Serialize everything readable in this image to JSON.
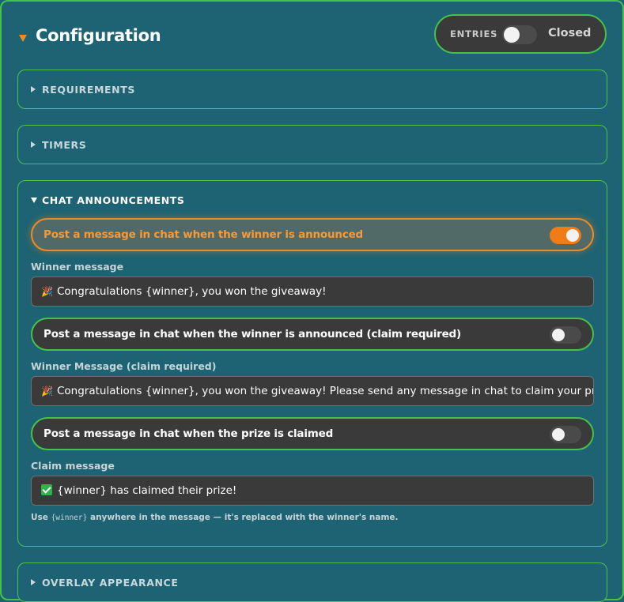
{
  "header": {
    "title": "Configuration",
    "entries_label": "ENTRIES",
    "entries_state": "Closed",
    "entries_open": false
  },
  "sections": {
    "requirements": {
      "label": "REQUIREMENTS",
      "expanded": false
    },
    "timers": {
      "label": "TIMERS",
      "expanded": false
    },
    "chat_announcements": {
      "label": "CHAT ANNOUNCEMENTS",
      "expanded": true,
      "winner_toggle": {
        "label": "Post a message in chat when the winner is announced",
        "on": true
      },
      "winner_message": {
        "label": "Winner message",
        "icon": "party-popper-icon",
        "value": "Congratulations {winner}, you won the giveaway!"
      },
      "claim_toggle": {
        "label": "Post a message in chat when the winner is announced (claim required)",
        "on": false
      },
      "claim_required_message": {
        "label": "Winner Message (claim required)",
        "icon": "party-popper-icon",
        "value": "Congratulations {winner}, you won the giveaway! Please send any message in chat to claim your prize!"
      },
      "claimed_toggle": {
        "label": "Post a message in chat when the prize is claimed",
        "on": false
      },
      "claim_message": {
        "label": "Claim message",
        "icon": "check-box-icon",
        "value": "{winner} has claimed their prize!"
      },
      "hint_prefix": "Use ",
      "hint_code": "{winner}",
      "hint_suffix": " anywhere in the message — it's replaced with the winner's name."
    },
    "overlay_appearance": {
      "label": "OVERLAY APPEARANCE",
      "expanded": false
    }
  },
  "colors": {
    "background": "#1d6373",
    "border_green": "#46c24a",
    "accent_orange": "#f08a23",
    "dark_field": "#3a3a3a"
  }
}
